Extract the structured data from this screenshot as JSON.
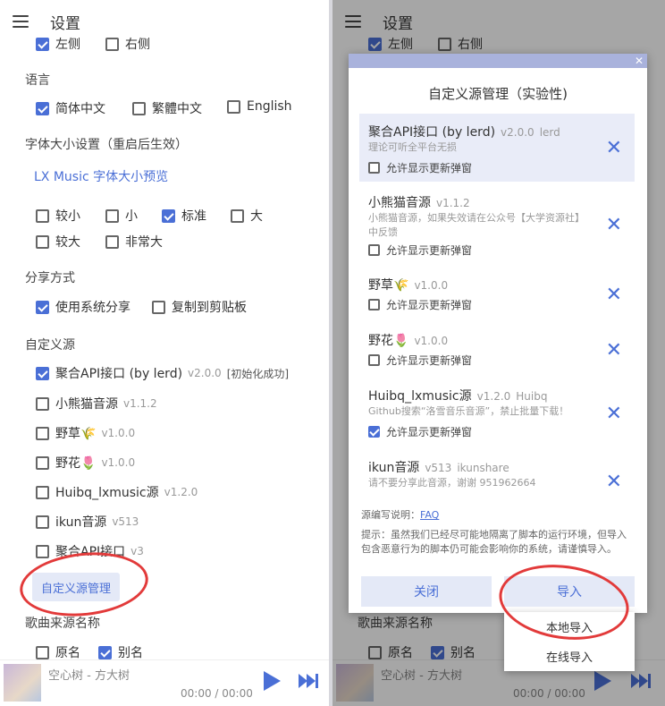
{
  "left": {
    "appbar": {
      "title": "设置"
    },
    "position": {
      "options": [
        {
          "label": "左侧",
          "checked": true
        },
        {
          "label": "右侧",
          "checked": false
        }
      ]
    },
    "language": {
      "title": "语言",
      "options": [
        {
          "label": "简体中文",
          "checked": true
        },
        {
          "label": "繁體中文",
          "checked": false
        },
        {
          "label": "English",
          "checked": false
        }
      ]
    },
    "font_size": {
      "title": "字体大小设置（重启后生效）",
      "preview": "LX Music 字体大小预览",
      "options": [
        {
          "label": "较小",
          "checked": false
        },
        {
          "label": "小",
          "checked": false
        },
        {
          "label": "标准",
          "checked": true
        },
        {
          "label": "大",
          "checked": false
        },
        {
          "label": "较大",
          "checked": false
        },
        {
          "label": "非常大",
          "checked": false
        }
      ]
    },
    "share": {
      "title": "分享方式",
      "options": [
        {
          "label": "使用系统分享",
          "checked": true
        },
        {
          "label": "复制到剪贴板",
          "checked": false
        }
      ]
    },
    "custom_source": {
      "title": "自定义源",
      "items": [
        {
          "name": "聚合API接口 (by lerd)",
          "version": "v2.0.0",
          "status": "[初始化成功]",
          "checked": true
        },
        {
          "name": "小熊猫音源",
          "version": "v1.1.2",
          "checked": false
        },
        {
          "name": "野草🌾",
          "version": "v1.0.0",
          "checked": false
        },
        {
          "name": "野花🌷",
          "version": "v1.0.0",
          "checked": false
        },
        {
          "name": "Huibq_lxmusic源",
          "version": "v1.2.0",
          "checked": false
        },
        {
          "name": "ikun音源",
          "version": "v513",
          "checked": false
        },
        {
          "name": "聚合API接口",
          "version": "v3",
          "checked": false
        }
      ],
      "manage_button": "自定义源管理"
    },
    "song_source_name": {
      "title": "歌曲来源名称",
      "options": [
        {
          "label": "原名",
          "checked": false
        },
        {
          "label": "别名",
          "checked": true
        }
      ]
    }
  },
  "player": {
    "track": "空心树 - 方大树",
    "time": "00:00 / 00:00"
  },
  "dialog": {
    "title": "自定义源管理（实验性)",
    "allow_update_label": "允许显示更新弹窗",
    "sources": [
      {
        "name": "聚合API接口 (by lerd)",
        "version": "v2.0.0",
        "author": "lerd",
        "desc": "理论可听全平台无损",
        "allow_update": false
      },
      {
        "name": "小熊猫音源",
        "version": "v1.1.2",
        "author": "",
        "desc": "小熊猫音源，如果失效请在公众号【大学资源社】中反馈",
        "allow_update": false
      },
      {
        "name": "野草🌾",
        "version": "v1.0.0",
        "author": "",
        "desc": "",
        "allow_update": false
      },
      {
        "name": "野花🌷",
        "version": "v1.0.0",
        "author": "",
        "desc": "",
        "allow_update": false
      },
      {
        "name": "Huibq_lxmusic源",
        "version": "v1.2.0",
        "author": "Huibq",
        "desc": "Github搜索“洛雪音乐音源”，禁止批量下载！",
        "allow_update": true
      },
      {
        "name": "ikun音源",
        "version": "v513",
        "author": "ikunshare",
        "desc": "请不要分享此音源，谢谢 951962664",
        "allow_update": null
      }
    ],
    "faq_prefix": "源编写说明：",
    "faq_link": "FAQ",
    "warning": "提示：虽然我们已经尽可能地隔离了脚本的运行环境，但导入包含恶意行为的脚本仍可能会影响你的系统，请谨慎导入。",
    "close_button": "关闭",
    "import_button": "导入",
    "import_menu": [
      "本地导入",
      "在线导入"
    ]
  },
  "colors": {
    "accent": "#4a6fd6",
    "annotation": "#e23a3a"
  },
  "icons": {
    "menu": "hamburger-icon",
    "play": "play-icon",
    "next": "skip-next-icon",
    "delete": "close-icon"
  }
}
